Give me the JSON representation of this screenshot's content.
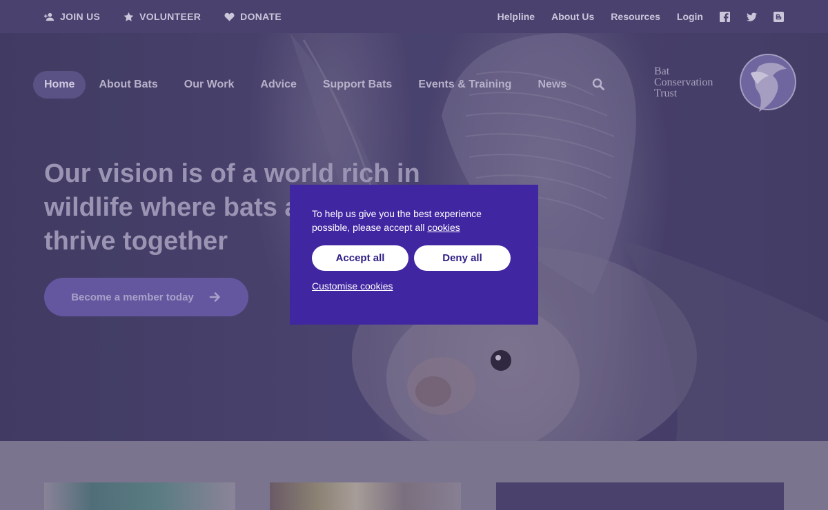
{
  "topbar": {
    "join": {
      "label": "JOIN US",
      "icon": "add-person-icon"
    },
    "volunteer": {
      "label": "VOLUNTEER",
      "icon": "star-icon"
    },
    "donate": {
      "label": "DONATE",
      "icon": "heart-icon"
    },
    "links": [
      "Helpline",
      "About Us",
      "Resources",
      "Login"
    ],
    "social": [
      "facebook-icon",
      "twitter-icon",
      "blogger-icon"
    ]
  },
  "nav": {
    "items": [
      "Home",
      "About Bats",
      "Our Work",
      "Advice",
      "Support Bats",
      "Events & Training",
      "News"
    ],
    "active": "Home",
    "search_icon": "search-icon"
  },
  "logo": {
    "line1": "Bat",
    "line2": "Conservation",
    "line3": "Trust"
  },
  "hero": {
    "title": "Our vision is of a world rich in wildlife where bats and people thrive together",
    "cta_label": "Become a member today"
  },
  "cookie": {
    "text": "To help us give you the best experience possible, please accept all",
    "link": "cookies",
    "accept_label": "Accept all",
    "deny_label": "Deny all",
    "customise_label": "Customise cookies"
  },
  "colors": {
    "topbar": "#4b416f",
    "cookie_bg": "#4126a1",
    "cookie_button_text": "#2f1e86",
    "cta": "#6457a0"
  }
}
